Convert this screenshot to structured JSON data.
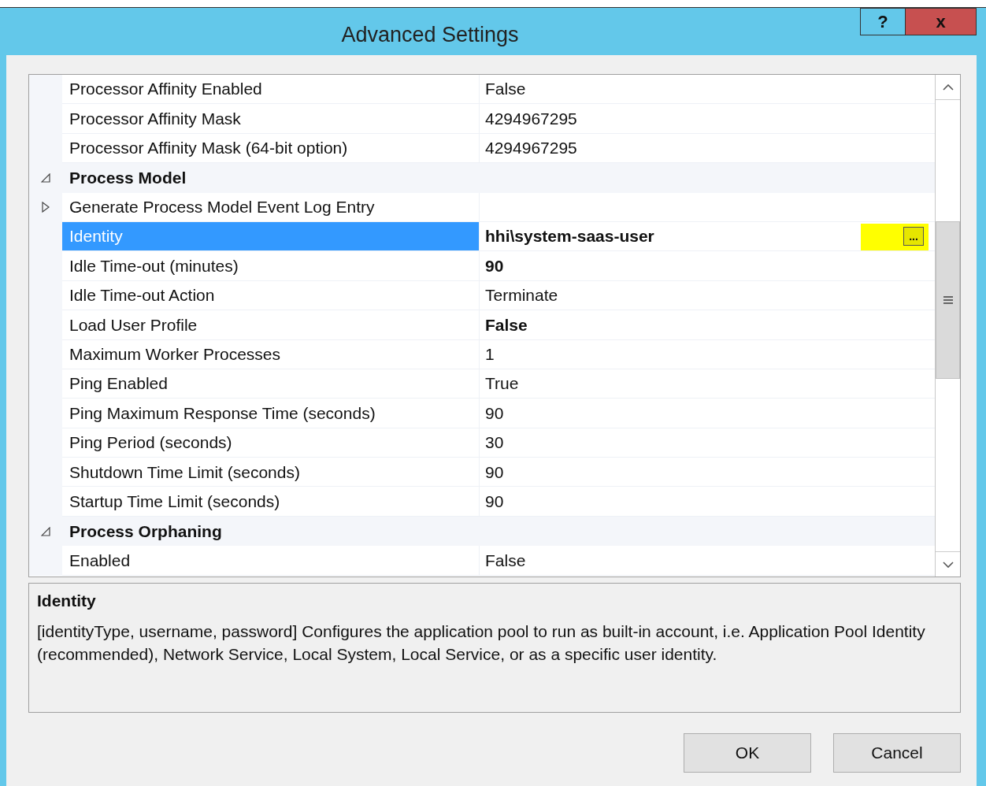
{
  "window": {
    "title": "Advanced Settings",
    "help_button": "?",
    "close_button": "x"
  },
  "grid": {
    "rows": [
      {
        "kind": "property",
        "name": "Processor Affinity Enabled",
        "value": "False",
        "bold": false,
        "selected": false,
        "expandable": false
      },
      {
        "kind": "property",
        "name": "Processor Affinity Mask",
        "value": "4294967295",
        "bold": false,
        "selected": false,
        "expandable": false
      },
      {
        "kind": "property",
        "name": "Processor Affinity Mask (64-bit option)",
        "value": "4294967295",
        "bold": false,
        "selected": false,
        "expandable": false
      },
      {
        "kind": "category",
        "name": "Process Model",
        "expanded": true
      },
      {
        "kind": "property",
        "name": "Generate Process Model Event Log Entry",
        "selected": false,
        "expandable": true
      },
      {
        "kind": "property",
        "name": "Identity",
        "value": "hhi\\system-saas-user",
        "bold": true,
        "selected": true,
        "expandable": false,
        "edit_button": "...",
        "highlighted": true
      },
      {
        "kind": "property",
        "name": "Idle Time-out (minutes)",
        "value": "90",
        "bold": true,
        "selected": false,
        "expandable": false
      },
      {
        "kind": "property",
        "name": "Idle Time-out Action",
        "value": "Terminate",
        "bold": false,
        "selected": false,
        "expandable": false
      },
      {
        "kind": "property",
        "name": "Load User Profile",
        "value": "False",
        "bold": true,
        "selected": false,
        "expandable": false
      },
      {
        "kind": "property",
        "name": "Maximum Worker Processes",
        "value": "1",
        "bold": false,
        "selected": false,
        "expandable": false
      },
      {
        "kind": "property",
        "name": "Ping Enabled",
        "value": "True",
        "bold": false,
        "selected": false,
        "expandable": false
      },
      {
        "kind": "property",
        "name": "Ping Maximum Response Time (seconds)",
        "value": "90",
        "bold": false,
        "selected": false,
        "expandable": false
      },
      {
        "kind": "property",
        "name": "Ping Period (seconds)",
        "value": "30",
        "bold": false,
        "selected": false,
        "expandable": false
      },
      {
        "kind": "property",
        "name": "Shutdown Time Limit (seconds)",
        "value": "90",
        "bold": false,
        "selected": false,
        "expandable": false
      },
      {
        "kind": "property",
        "name": "Startup Time Limit (seconds)",
        "value": "90",
        "bold": false,
        "selected": false,
        "expandable": false
      },
      {
        "kind": "category",
        "name": "Process Orphaning",
        "expanded": true
      },
      {
        "kind": "property",
        "name": "Enabled",
        "value": "False",
        "bold": false,
        "selected": false,
        "expandable": false
      }
    ]
  },
  "description": {
    "title": "Identity",
    "text": "[identityType, username, password] Configures the application pool to run as built-in account, i.e. Application Pool Identity (recommended), Network Service, Local System, Local Service, or as a specific user identity."
  },
  "buttons": [
    "OK",
    "Cancel"
  ]
}
